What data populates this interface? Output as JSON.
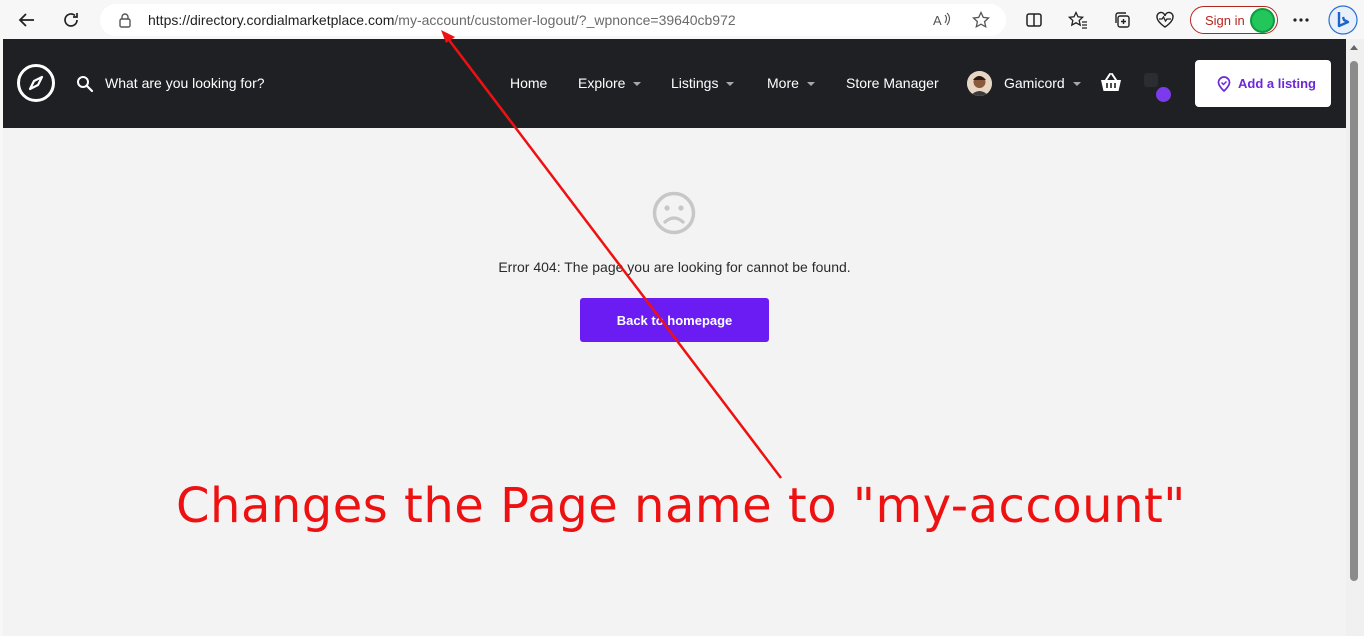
{
  "browser": {
    "url_host": "https://directory.cordialmarketplace.com",
    "url_path": "/my-account/customer-logout/?_wpnonce=39640cb972",
    "sign_in_label": "Sign in"
  },
  "header": {
    "search_placeholder": "What are you looking for?",
    "nav": {
      "home": "Home",
      "explore": "Explore",
      "listings": "Listings",
      "more": "More",
      "store_manager": "Store Manager",
      "user": "Gamicord"
    },
    "add_listing_label": "Add a listing"
  },
  "main": {
    "error_message": "Error 404: The page you are looking for cannot be found.",
    "back_button_label": "Back to homepage"
  },
  "annotation": {
    "text": "Changes the Page name to \"my-account\""
  },
  "colors": {
    "header_bg": "#1f2023",
    "accent": "#6a1cf2",
    "annotation": "#ee1111"
  }
}
